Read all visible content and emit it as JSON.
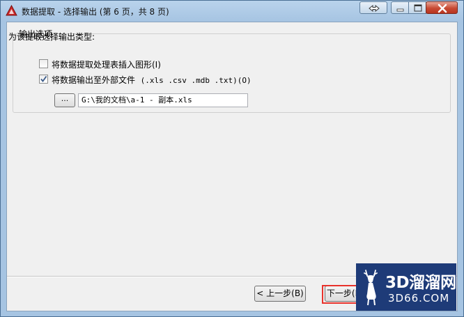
{
  "window": {
    "title": "数据提取 - 选择输出 (第 6 页，共 8 页)"
  },
  "output_options": {
    "group_title": "输出选项",
    "prompt": "为该提取选择输出类型:",
    "insert_table": {
      "label": "将数据提取处理表插入图形(I)",
      "checked": false
    },
    "external_file": {
      "label": "将数据输出至外部文件",
      "formats": "(.xls .csv .mdb .txt)(O)",
      "checked": true
    },
    "browse_label": "...",
    "path_value": "G:\\我的文档\\a-1 - 副本.xls"
  },
  "nav": {
    "back_label": "< 上一步(B)",
    "next_label": "下一步(N) >"
  },
  "watermark": {
    "brand": "3D溜溜网",
    "url": "3D66.COM"
  },
  "colors": {
    "app_icon": "#cc2a2a",
    "highlight": "#e8322b",
    "watermark_bg": "#1e3b78"
  }
}
